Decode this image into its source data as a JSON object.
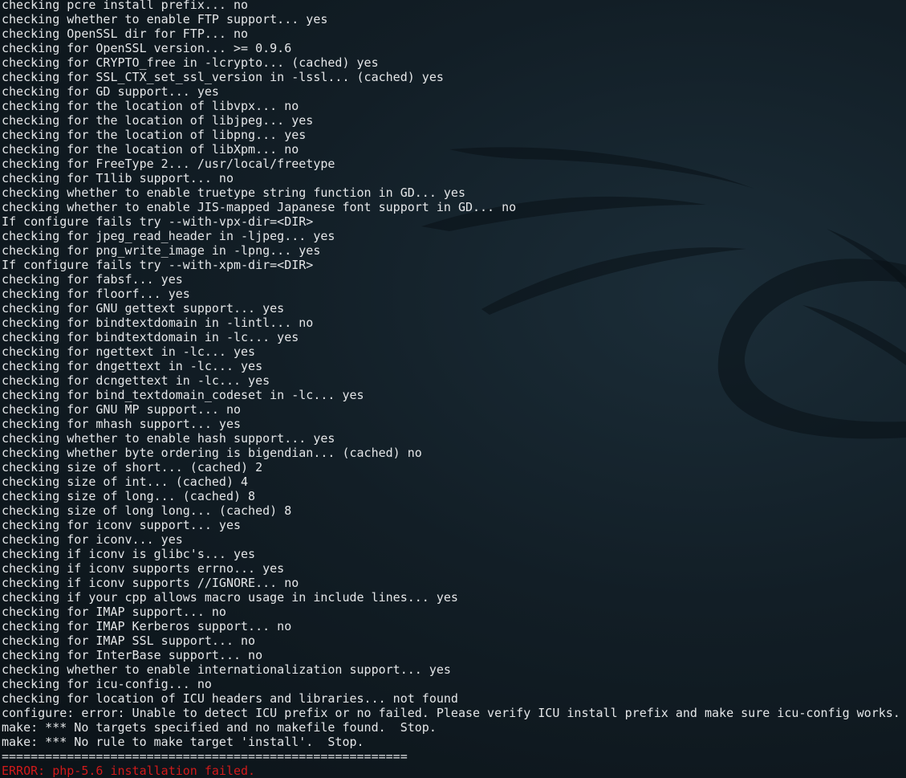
{
  "terminal": {
    "lines": [
      "checking pcre install prefix... no",
      "checking whether to enable FTP support... yes",
      "checking OpenSSL dir for FTP... no",
      "checking for OpenSSL version... >= 0.9.6",
      "checking for CRYPTO_free in -lcrypto... (cached) yes",
      "checking for SSL_CTX_set_ssl_version in -lssl... (cached) yes",
      "checking for GD support... yes",
      "checking for the location of libvpx... no",
      "checking for the location of libjpeg... yes",
      "checking for the location of libpng... yes",
      "checking for the location of libXpm... no",
      "checking for FreeType 2... /usr/local/freetype",
      "checking for T1lib support... no",
      "checking whether to enable truetype string function in GD... yes",
      "checking whether to enable JIS-mapped Japanese font support in GD... no",
      "If configure fails try --with-vpx-dir=<DIR>",
      "checking for jpeg_read_header in -ljpeg... yes",
      "checking for png_write_image in -lpng... yes",
      "If configure fails try --with-xpm-dir=<DIR>",
      "checking for fabsf... yes",
      "checking for floorf... yes",
      "checking for GNU gettext support... yes",
      "checking for bindtextdomain in -lintl... no",
      "checking for bindtextdomain in -lc... yes",
      "checking for ngettext in -lc... yes",
      "checking for dngettext in -lc... yes",
      "checking for dcngettext in -lc... yes",
      "checking for bind_textdomain_codeset in -lc... yes",
      "checking for GNU MP support... no",
      "checking for mhash support... yes",
      "checking whether to enable hash support... yes",
      "checking whether byte ordering is bigendian... (cached) no",
      "checking size of short... (cached) 2",
      "checking size of int... (cached) 4",
      "checking size of long... (cached) 8",
      "checking size of long long... (cached) 8",
      "checking for iconv support... yes",
      "checking for iconv... yes",
      "checking if iconv is glibc's... yes",
      "checking if iconv supports errno... yes",
      "checking if iconv supports //IGNORE... no",
      "checking if your cpp allows macro usage in include lines... yes",
      "checking for IMAP support... no",
      "checking for IMAP Kerberos support... no",
      "checking for IMAP SSL support... no",
      "checking for InterBase support... no",
      "checking whether to enable internationalization support... yes",
      "checking for icu-config... no",
      "checking for location of ICU headers and libraries... not found",
      "configure: error: Unable to detect ICU prefix or no failed. Please verify ICU install prefix and make sure icu-config works.",
      "make: *** No targets specified and no makefile found.  Stop.",
      "make: *** No rule to make target 'install'.  Stop.",
      "========================================================"
    ],
    "error_line": "ERROR: php-5.6 installation failed."
  },
  "colors": {
    "background": "#121e26",
    "text": "#e4e6e8",
    "error": "#d11a1a",
    "watermark": "#0a1116"
  }
}
